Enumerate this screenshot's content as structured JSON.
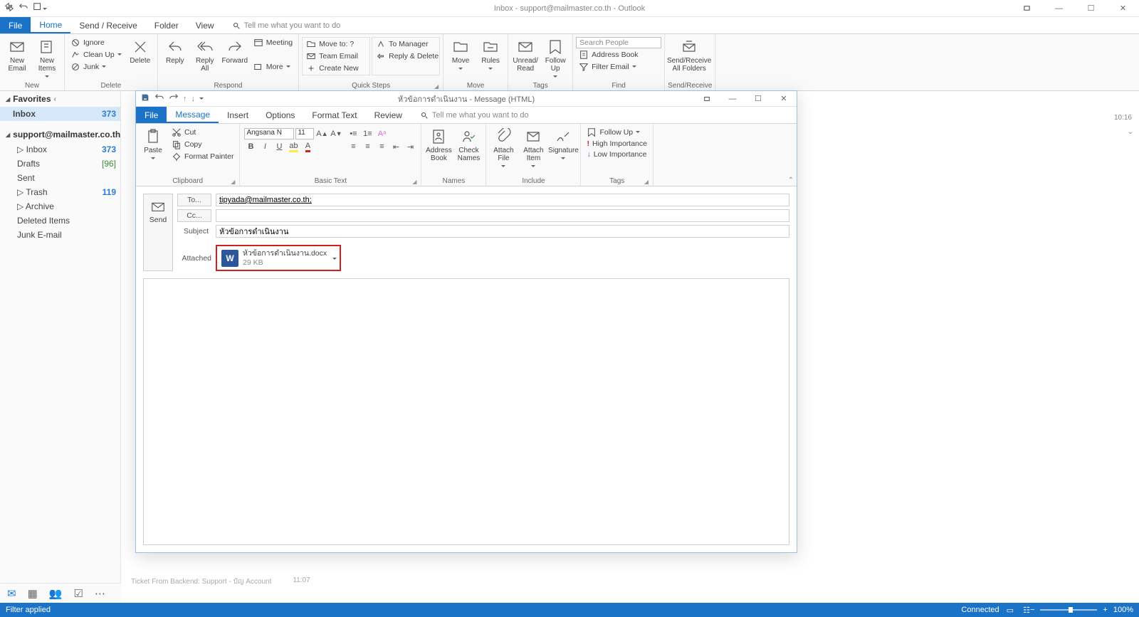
{
  "mainWindow": {
    "title": "Inbox - support@mailmaster.co.th - Outlook",
    "clock": "10:16",
    "tabs": {
      "file": "File",
      "home": "Home",
      "sendReceive": "Send / Receive",
      "folder": "Folder",
      "view": "View",
      "tellme": "Tell me what you want to do"
    },
    "ribbon": {
      "new": {
        "newEmail": "New\nEmail",
        "newItems": "New\nItems",
        "label": "New"
      },
      "delete": {
        "ignore": "Ignore",
        "cleanUp": "Clean Up",
        "junk": "Junk",
        "delete": "Delete",
        "label": "Delete"
      },
      "respond": {
        "reply": "Reply",
        "replyAll": "Reply\nAll",
        "forward": "Forward",
        "meeting": "Meeting",
        "more": "More",
        "label": "Respond"
      },
      "quickSteps": {
        "moveTo": "Move to: ?",
        "teamEmail": "Team Email",
        "createNew": "Create New",
        "toManager": "To Manager",
        "replyDelete": "Reply & Delete",
        "label": "Quick Steps"
      },
      "move": {
        "move": "Move",
        "rules": "Rules",
        "label": "Move"
      },
      "tags": {
        "unread": "Unread/\nRead",
        "followUp": "Follow\nUp",
        "label": "Tags"
      },
      "find": {
        "searchPlaceholder": "Search People",
        "addressBook": "Address Book",
        "filterEmail": "Filter Email",
        "label": "Find"
      },
      "sendReceive": {
        "btn": "Send/Receive\nAll Folders",
        "label": "Send/Receive"
      }
    },
    "nav": {
      "favorites": "Favorites",
      "inbox": "Inbox",
      "inboxCount": "373",
      "account": "support@mailmaster.co.th",
      "inbox2": "Inbox",
      "inbox2Count": "373",
      "drafts": "Drafts",
      "draftsCount": "[96]",
      "sent": "Sent",
      "trash": "Trash",
      "trashCount": "119",
      "archive": "Archive",
      "deleted": "Deleted Items",
      "junk": "Junk E-mail"
    },
    "status": {
      "filter": "Filter applied",
      "connected": "Connected",
      "zoom": "100%"
    },
    "footerLine": "Ticket From Backend: Support - บัญ Account",
    "footerTime": "11:07"
  },
  "compose": {
    "title": "หัวข้อการดำเนินงาน  -  Message (HTML)",
    "tabs": {
      "file": "File",
      "message": "Message",
      "insert": "Insert",
      "options": "Options",
      "format": "Format Text",
      "review": "Review",
      "tellme": "Tell me what you want to do"
    },
    "ribbon": {
      "clipboard": {
        "paste": "Paste",
        "cut": "Cut",
        "copy": "Copy",
        "painter": "Format Painter",
        "label": "Clipboard"
      },
      "basicText": {
        "font": "Angsana N",
        "size": "11",
        "label": "Basic Text"
      },
      "names": {
        "addressBook": "Address\nBook",
        "checkNames": "Check\nNames",
        "label": "Names"
      },
      "include": {
        "attachFile": "Attach\nFile",
        "attachItem": "Attach\nItem",
        "signature": "Signature",
        "label": "Include"
      },
      "tags": {
        "followUp": "Follow Up",
        "high": "High Importance",
        "low": "Low Importance",
        "label": "Tags"
      }
    },
    "fields": {
      "send": "Send",
      "to": "To...",
      "cc": "Cc...",
      "subject": "Subject",
      "attached": "Attached",
      "toValue": "tipyada@mailmaster.co.th;",
      "ccValue": "",
      "subjectValue": "หัวข้อการดำเนินงาน"
    },
    "attachment": {
      "name": "หัวข้อการดำเนินงาน.docx",
      "size": "29 KB",
      "iconLetter": "W"
    }
  }
}
